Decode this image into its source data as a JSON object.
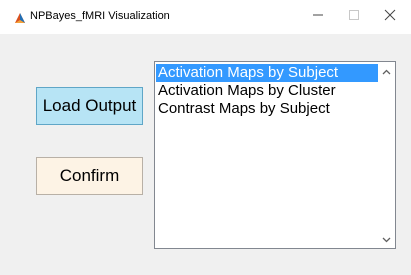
{
  "window": {
    "title": "NPBayes_fMRI Visualization",
    "app_icon": "matlab-figure-icon",
    "controls": {
      "minimize_icon": "minimize-icon",
      "maximize_icon": "maximize-icon",
      "close_icon": "close-icon"
    }
  },
  "buttons": {
    "load_label": "Load Output",
    "confirm_label": "Confirm"
  },
  "listbox": {
    "items": [
      "Activation Maps by Subject",
      "Activation Maps by Cluster",
      "Contrast Maps by Subject"
    ],
    "selected_index": 0,
    "scroll_up_icon": "chevron-up-icon",
    "scroll_down_icon": "chevron-down-icon"
  },
  "colors": {
    "load_button_bg": "#b7e4f5",
    "confirm_button_bg": "#fdf3e5",
    "selection_bg": "#3399ff",
    "window_bg": "#f0f0f0"
  }
}
